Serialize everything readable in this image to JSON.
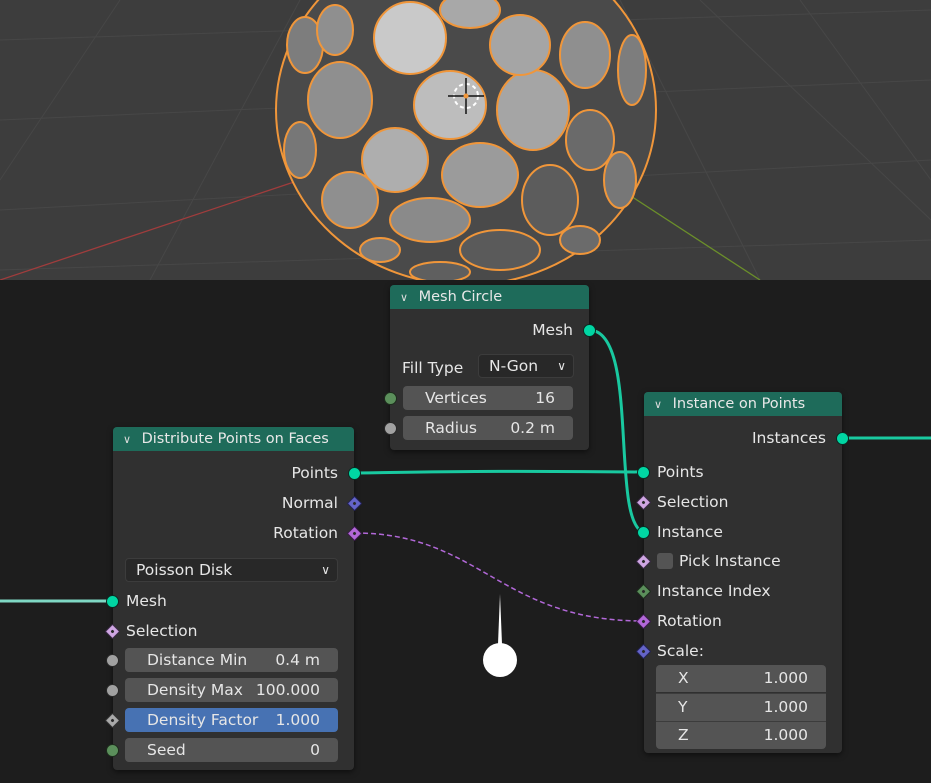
{
  "nodes": {
    "mesh_circle": {
      "title": "Mesh Circle",
      "output_mesh": "Mesh",
      "fill_type_label": "Fill Type",
      "fill_type_value": "N-Gon",
      "vertices_label": "Vertices",
      "vertices_value": "16",
      "radius_label": "Radius",
      "radius_value": "0.2 m"
    },
    "distribute": {
      "title": "Distribute Points on Faces",
      "out_points": "Points",
      "out_normal": "Normal",
      "out_rotation": "Rotation",
      "mode": "Poisson Disk",
      "in_mesh": "Mesh",
      "in_selection": "Selection",
      "distance_min_label": "Distance Min",
      "distance_min_value": "0.4 m",
      "density_max_label": "Density Max",
      "density_max_value": "100.000",
      "density_factor_label": "Density Factor",
      "density_factor_value": "1.000",
      "seed_label": "Seed",
      "seed_value": "0"
    },
    "instance_on_points": {
      "title": "Instance on Points",
      "out_instances": "Instances",
      "in_points": "Points",
      "in_selection": "Selection",
      "in_instance": "Instance",
      "pick_instance": "Pick Instance",
      "instance_index": "Instance Index",
      "rotation": "Rotation",
      "scale": "Scale:",
      "x_label": "X",
      "x_value": "1.000",
      "y_label": "Y",
      "y_value": "1.000",
      "z_label": "Z",
      "z_value": "1.000"
    }
  },
  "colors": {
    "header": "#1e6b5a",
    "geometry_socket": "#00d6a3",
    "rotation_wire": "#b268d8",
    "selection_orange": "#f0963a",
    "active_field": "#4772b3"
  }
}
